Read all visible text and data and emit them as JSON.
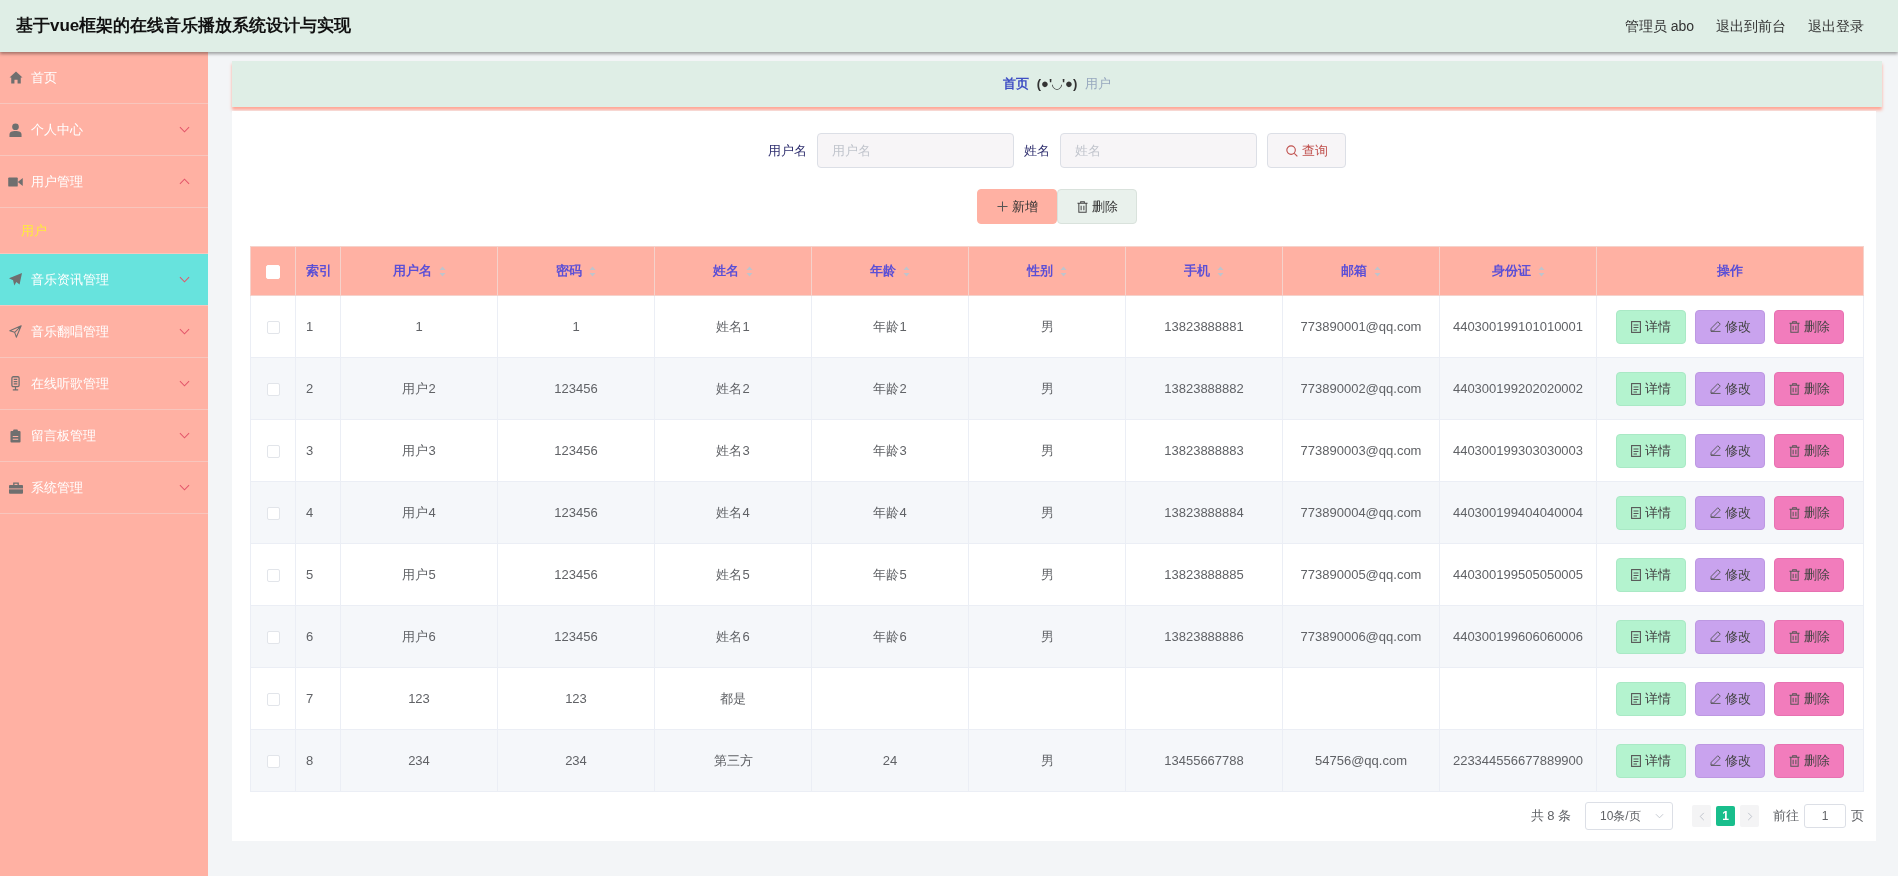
{
  "topbar": {
    "title": "基于vue框架的在线音乐播放系统设计与实现",
    "user": "管理员 abo",
    "links": [
      "退出到前台",
      "退出登录"
    ]
  },
  "sidebar": {
    "items": [
      {
        "label": "首页",
        "kind": "link",
        "highlighted": false
      },
      {
        "label": "个人中心",
        "kind": "menu",
        "expanded": false,
        "highlighted": false
      },
      {
        "label": "用户管理",
        "kind": "menu",
        "expanded": true,
        "highlighted": false,
        "children": [
          {
            "label": "用户",
            "selected": true
          }
        ]
      },
      {
        "label": "音乐资讯管理",
        "kind": "menu",
        "expanded": false,
        "highlighted": true
      },
      {
        "label": "音乐翻唱管理",
        "kind": "menu",
        "expanded": false,
        "highlighted": false
      },
      {
        "label": "在线听歌管理",
        "kind": "menu",
        "expanded": false,
        "highlighted": false
      },
      {
        "label": "留言板管理",
        "kind": "menu",
        "expanded": false,
        "highlighted": false
      },
      {
        "label": "系统管理",
        "kind": "menu",
        "expanded": false,
        "highlighted": false
      }
    ]
  },
  "breadcrumb": {
    "home": "首页",
    "separator": "(●'◡'●)",
    "current": "用户"
  },
  "search": {
    "fields": [
      {
        "label": "用户名",
        "placeholder": "用户名"
      },
      {
        "label": "姓名",
        "placeholder": "姓名"
      }
    ],
    "button": "查询"
  },
  "actions": [
    {
      "kind": "add",
      "label": "新增"
    },
    {
      "kind": "delete",
      "label": "删除"
    }
  ],
  "table": {
    "all_checked": false,
    "columns": [
      {
        "label": "索引",
        "sortable": false
      },
      {
        "label": "用户名",
        "sortable": true
      },
      {
        "label": "密码",
        "sortable": true
      },
      {
        "label": "姓名",
        "sortable": true
      },
      {
        "label": "年龄",
        "sortable": true
      },
      {
        "label": "性别",
        "sortable": true
      },
      {
        "label": "手机",
        "sortable": true
      },
      {
        "label": "邮箱",
        "sortable": true
      },
      {
        "label": "身份证",
        "sortable": true
      },
      {
        "label": "操作",
        "sortable": false
      }
    ],
    "rows": [
      {
        "checked": false,
        "cells": [
          "1",
          "1",
          "1",
          "姓名1",
          "年龄1",
          "男",
          "13823888881",
          "773890001@qq.com",
          "440300199101010001"
        ],
        "actions": [
          {
            "kind": "detail",
            "label": "详情"
          },
          {
            "kind": "edit",
            "label": "修改"
          },
          {
            "kind": "delete",
            "label": "删除"
          }
        ]
      },
      {
        "checked": false,
        "cells": [
          "2",
          "用户2",
          "123456",
          "姓名2",
          "年龄2",
          "男",
          "13823888882",
          "773890002@qq.com",
          "440300199202020002"
        ],
        "actions": [
          {
            "kind": "detail",
            "label": "详情"
          },
          {
            "kind": "edit",
            "label": "修改"
          },
          {
            "kind": "delete",
            "label": "删除"
          }
        ]
      },
      {
        "checked": false,
        "cells": [
          "3",
          "用户3",
          "123456",
          "姓名3",
          "年龄3",
          "男",
          "13823888883",
          "773890003@qq.com",
          "440300199303030003"
        ],
        "actions": [
          {
            "kind": "detail",
            "label": "详情"
          },
          {
            "kind": "edit",
            "label": "修改"
          },
          {
            "kind": "delete",
            "label": "删除"
          }
        ]
      },
      {
        "checked": false,
        "cells": [
          "4",
          "用户4",
          "123456",
          "姓名4",
          "年龄4",
          "男",
          "13823888884",
          "773890004@qq.com",
          "440300199404040004"
        ],
        "actions": [
          {
            "kind": "detail",
            "label": "详情"
          },
          {
            "kind": "edit",
            "label": "修改"
          },
          {
            "kind": "delete",
            "label": "删除"
          }
        ]
      },
      {
        "checked": false,
        "cells": [
          "5",
          "用户5",
          "123456",
          "姓名5",
          "年龄5",
          "男",
          "13823888885",
          "773890005@qq.com",
          "440300199505050005"
        ],
        "actions": [
          {
            "kind": "detail",
            "label": "详情"
          },
          {
            "kind": "edit",
            "label": "修改"
          },
          {
            "kind": "delete",
            "label": "删除"
          }
        ]
      },
      {
        "checked": false,
        "cells": [
          "6",
          "用户6",
          "123456",
          "姓名6",
          "年龄6",
          "男",
          "13823888886",
          "773890006@qq.com",
          "440300199606060006"
        ],
        "actions": [
          {
            "kind": "detail",
            "label": "详情"
          },
          {
            "kind": "edit",
            "label": "修改"
          },
          {
            "kind": "delete",
            "label": "删除"
          }
        ]
      },
      {
        "checked": false,
        "cells": [
          "7",
          "123",
          "123",
          "都是",
          null,
          null,
          null,
          null,
          null
        ],
        "actions": [
          {
            "kind": "detail",
            "label": "详情"
          },
          {
            "kind": "edit",
            "label": "修改"
          },
          {
            "kind": "delete",
            "label": "删除"
          }
        ]
      },
      {
        "checked": false,
        "cells": [
          "8",
          "234",
          "234",
          "第三方",
          "24",
          "男",
          "13455667788",
          "54756@qq.com",
          "223344556677889900"
        ],
        "actions": [
          {
            "kind": "detail",
            "label": "详情"
          },
          {
            "kind": "edit",
            "label": "修改"
          },
          {
            "kind": "delete",
            "label": "删除"
          }
        ]
      }
    ]
  },
  "pagination": {
    "total": "共 8 条",
    "page_size": "10条/页",
    "prev_disabled": true,
    "pages": [
      {
        "label": "1",
        "selected": true
      }
    ],
    "next_disabled": true,
    "goto_label": "前往",
    "goto_value": "1",
    "goto_suffix": "页"
  }
}
